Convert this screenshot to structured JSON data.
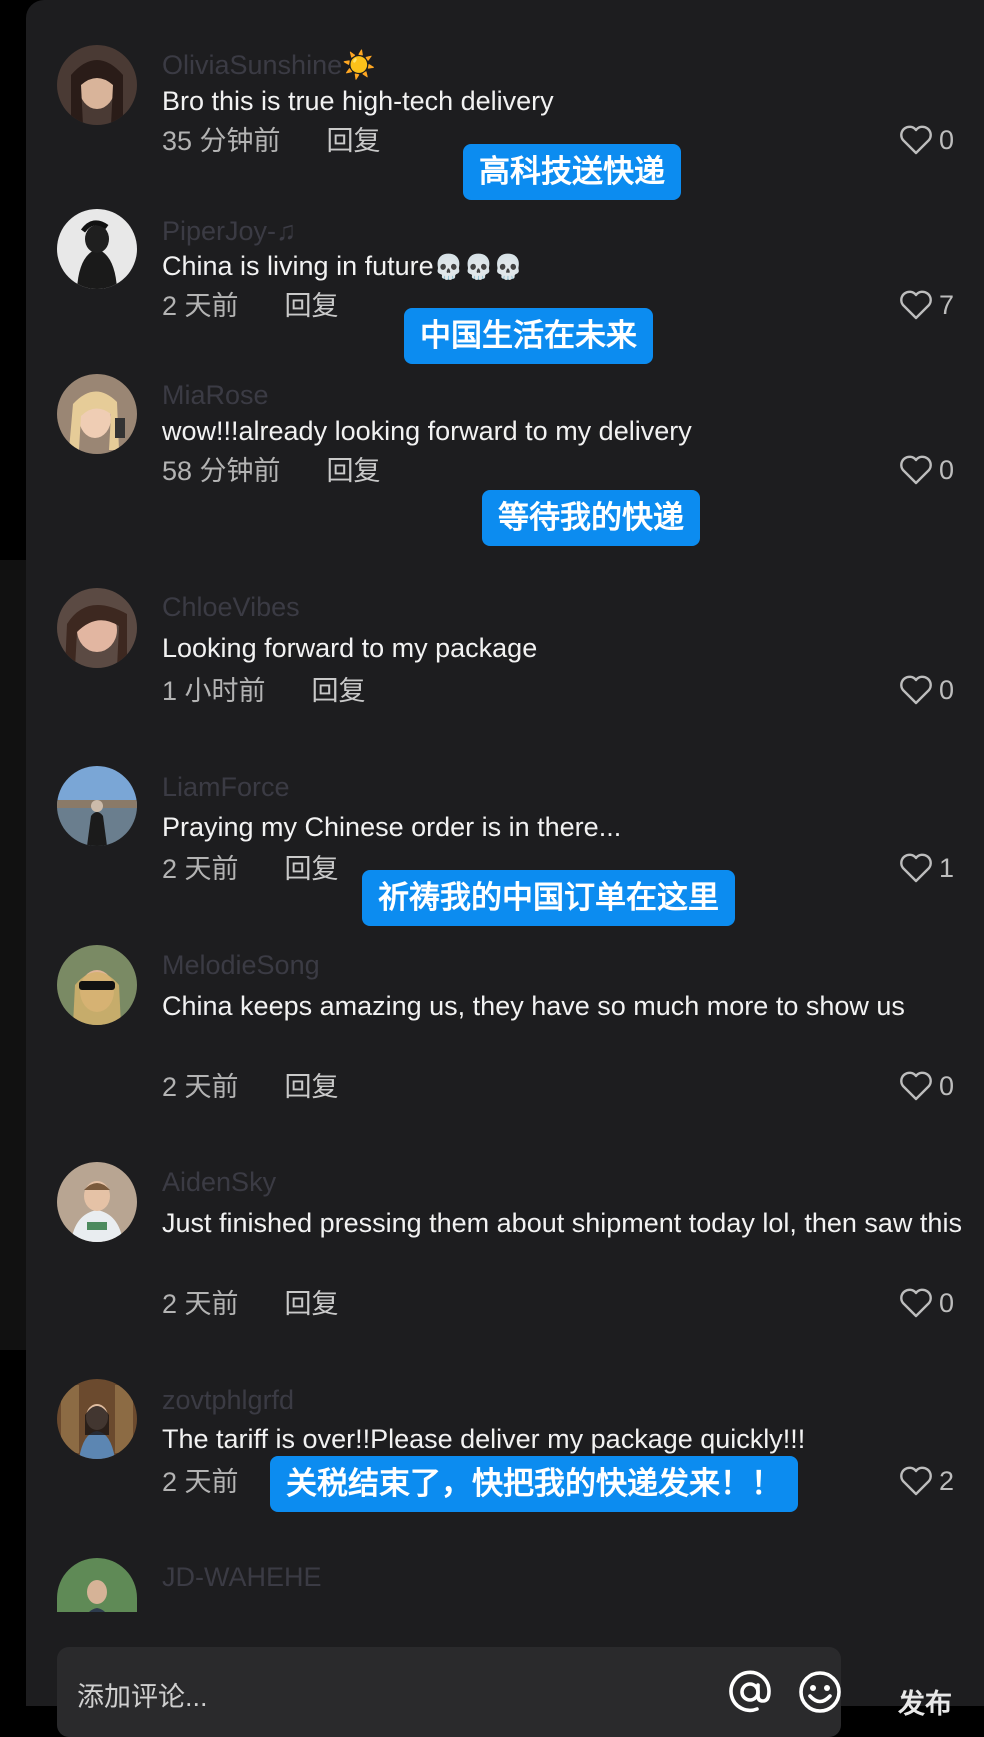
{
  "comments": [
    {
      "username": "OliviaSunshine",
      "username_suffix": "☀️",
      "text": "Bro this is true high-tech delivery",
      "time": "35 分钟前",
      "reply": "回复",
      "likes": "0",
      "caption": "高科技送快递"
    },
    {
      "username": "PiperJoy",
      "username_suffix": "-♫",
      "text": "China is living in future",
      "text_suffix": "💀💀💀",
      "time": "2 天前",
      "reply": "回复",
      "likes": "7",
      "caption": "中国生活在未来"
    },
    {
      "username": "MiaRose",
      "text": "wow!!!already looking forward to my delivery",
      "time": "58 分钟前",
      "reply": "回复",
      "likes": "0",
      "caption": "等待我的快递"
    },
    {
      "username": "ChloeVibes",
      "text": "Looking forward to my package",
      "time": "1 小时前",
      "reply": "回复",
      "likes": "0"
    },
    {
      "username": "LiamForce",
      "text": "Praying my Chinese order is in there...",
      "time": "2 天前",
      "reply": "回复",
      "likes": "1",
      "caption": "祈祷我的中国订单在这里"
    },
    {
      "username": "MelodieSong",
      "text": "China keeps amazing us, they have so much more to show us",
      "time": "2 天前",
      "reply": "回复",
      "likes": "0"
    },
    {
      "username": "AidenSky",
      "text": "Just finished pressing them about shipment today lol, then saw this",
      "time": "2 天前",
      "reply": "回复",
      "likes": "0"
    },
    {
      "username": "zovtphlgrfd",
      "text": "The tariff is over!!Please deliver my package quickly!!!",
      "time": "2 天前",
      "reply": "回复",
      "likes": "2",
      "caption": "关税结束了，快把我的快递发来！！"
    },
    {
      "username": "JD-WAHEHE"
    }
  ],
  "bottom_bar": {
    "placeholder": "添加评论...",
    "publish": "发布",
    "at_icon": "at-icon",
    "emoji_icon": "smile-icon"
  }
}
